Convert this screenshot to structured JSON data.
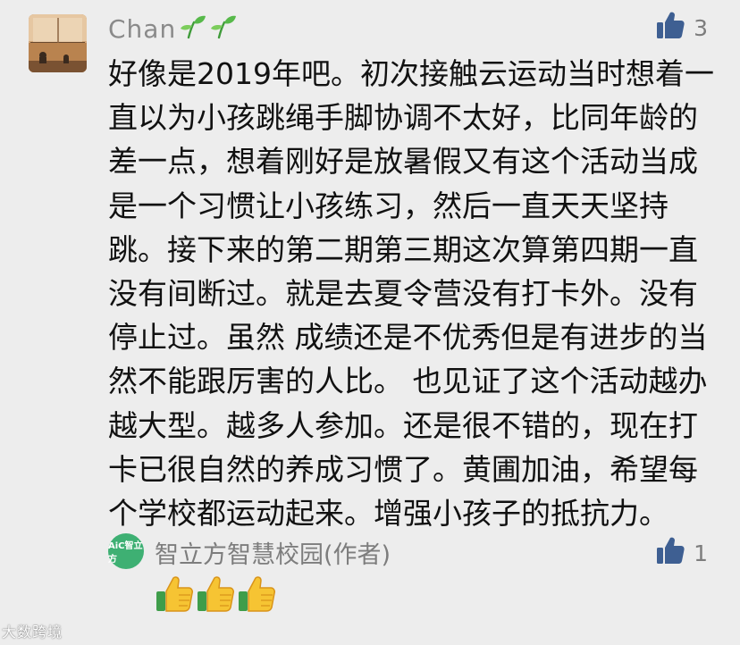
{
  "comment": {
    "author": "Chan",
    "like_count": "3",
    "text": "好像是2019年吧。初次接触云运动当时想着一直以为小孩跳绳手脚协调不太好，比同年龄的差一点，想着刚好是放暑假又有这个活动当成是一个习惯让小孩练习，然后一直天天坚持跳。接下来的第二期第三期这次算第四期一直没有间断过。就是去夏令营没有打卡外。没有停止过。虽然 成绩还是不优秀但是有进步的当然不能跟厉害的人比。 也见证了这个活动越办越大型。越多人参加。还是很不错的，现在打卡已很自然的养成习惯了。黄圃加油，希望每个学校都运动起来。增强小孩子的抵抗力。"
  },
  "reply": {
    "avatar_text": "AiC智立方",
    "author": "智立方智慧校园(作者)",
    "like_count": "1"
  },
  "watermark": "大数跨境",
  "colors": {
    "background": "#ededed",
    "muted_text": "#7d7d7d",
    "like_icon": "#3e5f92",
    "reply_avatar": "#3eb073"
  },
  "icons": {
    "sprout": "sprout-emoji",
    "like": "thumbs-up-icon",
    "reply_emoji": "thumbs-up-emoji"
  }
}
